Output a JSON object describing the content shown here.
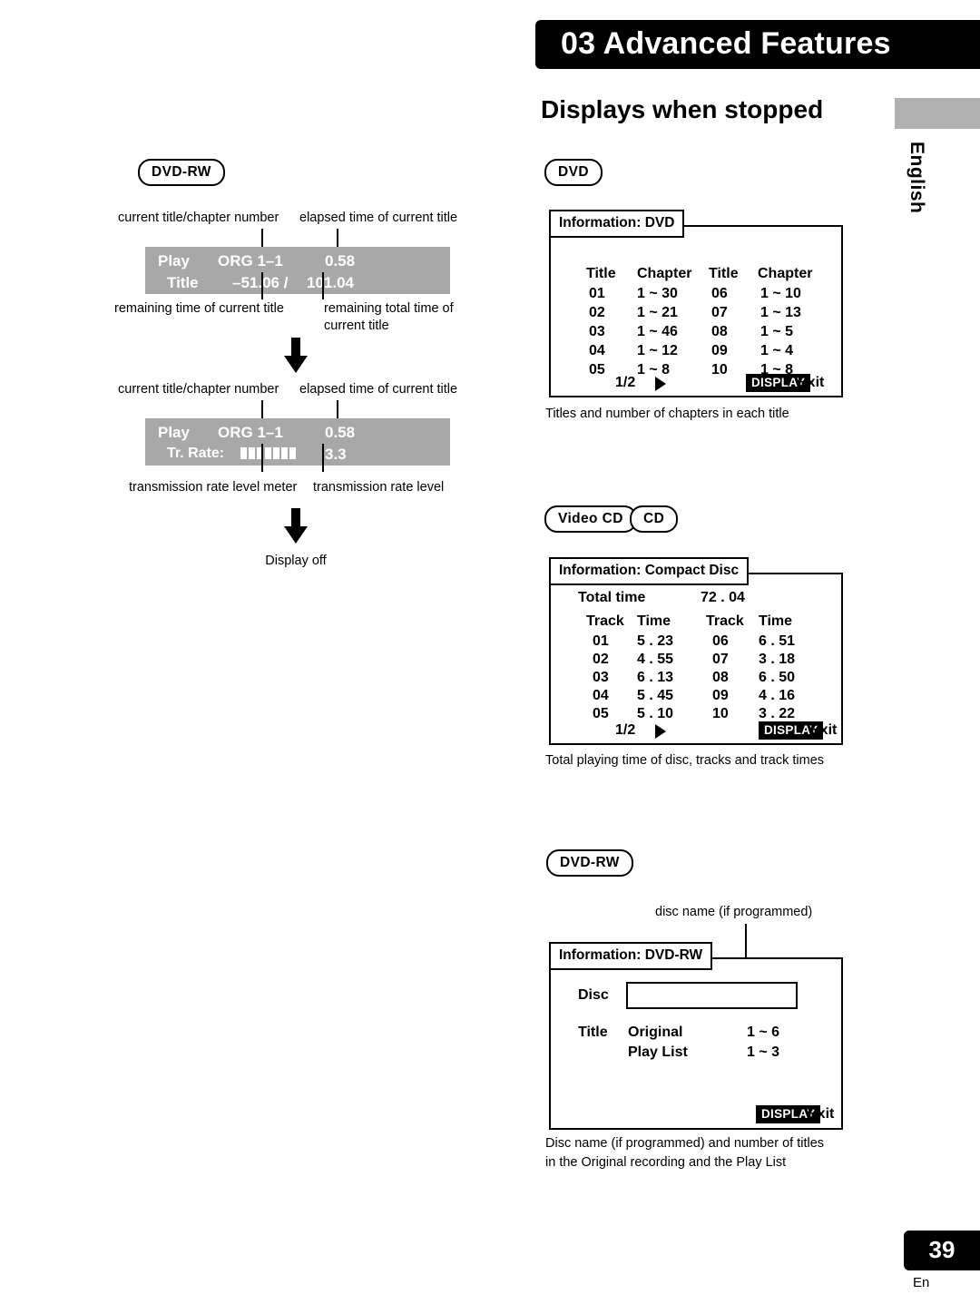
{
  "header": {
    "chapter_number": "03",
    "chapter_title": "03 Advanced Features",
    "section_title": "Displays when stopped",
    "language": "English"
  },
  "footer": {
    "page_number": "39",
    "language_code": "En"
  },
  "left_column": {
    "badge": "DVD-RW",
    "block1": {
      "caption_top_left": "current title/chapter number",
      "caption_top_right": "elapsed time of current title",
      "panel": {
        "r1c1": "Play",
        "r1c2": "ORG 1–1",
        "r1c3": "0.58",
        "r2c1": "Title",
        "r2c2": "–51.06 /",
        "r2c3": "101.04"
      },
      "caption_bottom_left": "remaining time of current title",
      "caption_bottom_right": "remaining total time of\ncurrent title"
    },
    "block2": {
      "caption_top_left": "current title/chapter number",
      "caption_top_right": "elapsed time of current title",
      "panel": {
        "r1c1": "Play",
        "r1c2": "ORG 1–1",
        "r1c3": "0.58",
        "r2c1": "Tr. Rate:",
        "r2c3": "3.3"
      },
      "caption_bottom_left": "transmission rate level meter",
      "caption_bottom_right": "transmission rate level"
    },
    "display_off": "Display off"
  },
  "right_column": {
    "dvd": {
      "badge": "DVD",
      "osd_title": "Information: DVD",
      "headers": [
        "Title",
        "Chapter",
        "Title",
        "Chapter"
      ],
      "rows": [
        [
          "01",
          "1 ~ 30",
          "06",
          "1 ~ 10"
        ],
        [
          "02",
          "1 ~ 21",
          "07",
          "1 ~ 13"
        ],
        [
          "03",
          "1 ~ 46",
          "08",
          "1 ~ 5"
        ],
        [
          "04",
          "1 ~ 12",
          "09",
          "1 ~ 4"
        ],
        [
          "05",
          "1 ~ 8",
          "10",
          "1 ~ 8"
        ]
      ],
      "page_indicator": "1/2",
      "display_button": "DISPLAY",
      "exit_label": "Exit",
      "caption": "Titles and number of chapters in each title"
    },
    "cd": {
      "badge1": "Video CD",
      "badge2": "CD",
      "osd_title": "Information: Compact Disc",
      "total_time_label": "Total time",
      "total_time_value": "72 . 04",
      "headers": [
        "Track",
        "Time",
        "Track",
        "Time"
      ],
      "rows": [
        [
          "01",
          "5 . 23",
          "06",
          "6 . 51"
        ],
        [
          "02",
          "4 . 55",
          "07",
          "3 . 18"
        ],
        [
          "03",
          "6 . 13",
          "08",
          "6 . 50"
        ],
        [
          "04",
          "5 . 45",
          "09",
          "4 . 16"
        ],
        [
          "05",
          "5 . 10",
          "10",
          "3 . 22"
        ]
      ],
      "page_indicator": "1/2",
      "display_button": "DISPLAY",
      "exit_label": "Exit",
      "caption": "Total playing time of disc, tracks and track times"
    },
    "dvdrw": {
      "badge": "DVD-RW",
      "caption_top": "disc name (if programmed)",
      "osd_title": "Information: DVD-RW",
      "disc_label": "Disc",
      "title_label": "Title",
      "original_label": "Original",
      "original_value": "1 ~ 6",
      "playlist_label": "Play List",
      "playlist_value": "1 ~ 3",
      "display_button": "DISPLAY",
      "exit_label": "Exit",
      "caption": "Disc name (if programmed) and number of titles\nin the Original recording and the Play List"
    }
  }
}
